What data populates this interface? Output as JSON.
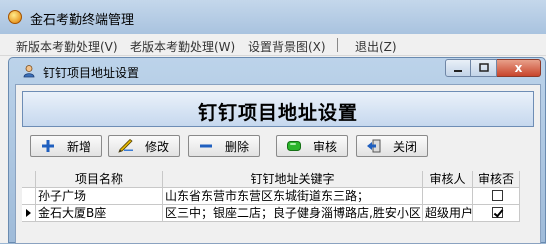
{
  "app": {
    "title": "金石考勤终端管理"
  },
  "menu": {
    "items": [
      {
        "label": "新版本考勤处理(V)"
      },
      {
        "label": "老版本考勤处理(W)"
      },
      {
        "label": "设置背景图(X)"
      },
      {
        "label": "退出(Z)"
      }
    ]
  },
  "window": {
    "title": "钉钉项目地址设置",
    "heading": "钉钉项目地址设置",
    "close_glyph": "x"
  },
  "toolbar": {
    "add_label": "新增",
    "edit_label": "修改",
    "delete_label": "删除",
    "review_label": "审核",
    "close_label": "关闭"
  },
  "grid": {
    "columns": [
      "项目名称",
      "钉钉地址关键字",
      "审核人",
      "审核否"
    ],
    "rows": [
      {
        "name": "孙子广场",
        "keyword": "山东省东营市东营区东城街道东三路；",
        "reviewer": "",
        "reviewed": false,
        "current": false
      },
      {
        "name": "金石大厦B座",
        "keyword": "区三中；银座二店；良子健身淄博路店,胜安小区",
        "reviewer": "超级用户",
        "reviewed": true,
        "current": true
      }
    ]
  },
  "colors": {
    "review_green": "#2bb52b",
    "close_red": "#c8452c",
    "add_blue": "#1f5fbf"
  }
}
